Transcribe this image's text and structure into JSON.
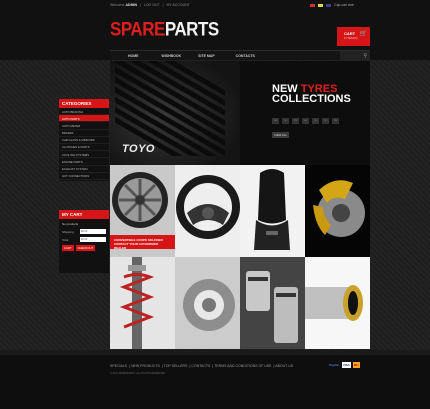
{
  "topbar": {
    "welcome": "Welcome",
    "user": "ADMIN",
    "link1": "LOG OUT",
    "link2": "MY ACCOUNT",
    "currency": "Сар сан иле"
  },
  "logo": {
    "part1": "SPARE",
    "part2": "PARTS"
  },
  "cart": {
    "label": "CART",
    "sub": "0 ITEM(S)"
  },
  "nav": [
    {
      "label": "HOME"
    },
    {
      "label": "WISHBOOK"
    },
    {
      "label": "SITE MAP"
    },
    {
      "label": "CONTACTS"
    }
  ],
  "hero": {
    "brand": "TOYO",
    "line1": "NEW",
    "line1_red": "TYRES",
    "line2": "COLLECTIONS",
    "specs": [
      "195",
      "14",
      "175",
      "60",
      "70",
      "65",
      "215"
    ],
    "button": "VIEW ALL"
  },
  "promo": {
    "line1": "CONVERTIBLE COUPE SKI-FINED",
    "line2": "CONTACT YOUR AUTHORIZED DEALER"
  },
  "categories": {
    "title": "CATEGORIES",
    "items": [
      {
        "label": "AUTO BRAKING",
        "active": false
      },
      {
        "label": "AUTO PARTS",
        "active": true
      },
      {
        "label": "AUTO METER",
        "active": false
      },
      {
        "label": "BRAKES",
        "active": false
      },
      {
        "label": "CAR GLASS & MIRRORS",
        "active": false
      },
      {
        "label": "CLUTCHES & PARTS",
        "active": false
      },
      {
        "label": "COOLING SYSTEMS",
        "active": false
      },
      {
        "label": "ENGINE PARTS",
        "active": false
      },
      {
        "label": "EXHAUST SYSTEM",
        "active": false
      },
      {
        "label": "LIFT CONNECTIONS",
        "active": false
      }
    ]
  },
  "mycart": {
    "title": "MY CART",
    "empty": "No products",
    "shipping_label": "Shipping",
    "shipping_value": "$0.00",
    "total_label": "Total",
    "total_value": "$0.00",
    "cart_btn": "CART",
    "checkout_btn": "CHECKOUT"
  },
  "footer": {
    "links": [
      "SPECIALS",
      "NEW PRODUCTS",
      "TOP SELLERS",
      "CONTACTS",
      "TERMS AND CONDITIONS OF USE",
      "ABOUT US"
    ],
    "copyright": "© 2011 SPAREPARTS. ALL RIGHTS RESERVED",
    "payments": [
      "PayPal",
      "VISA",
      "MC"
    ]
  },
  "colors": {
    "accent": "#d61616",
    "bg": "#1a1a1a"
  }
}
